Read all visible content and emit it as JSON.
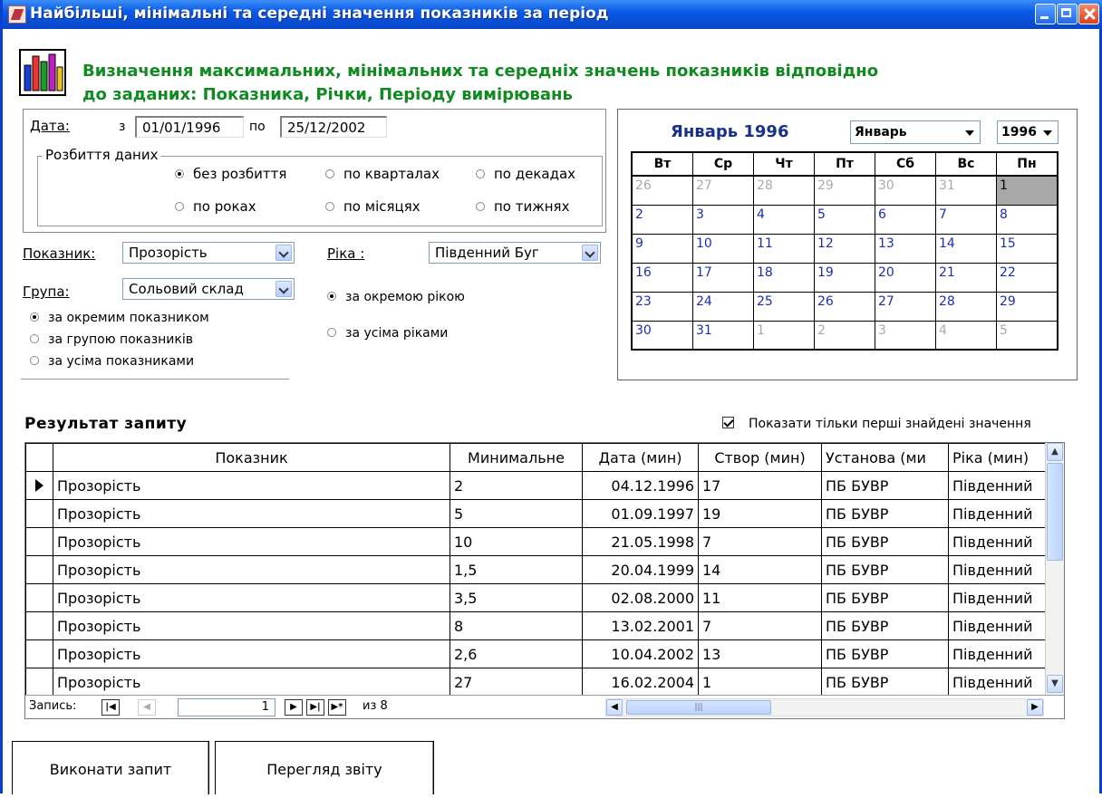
{
  "window": {
    "title": "Найбільші, мінімальні та середні значення показників за період"
  },
  "header": {
    "title": "Визначення максимальних, мінімальних та середніх значень показників відповідно до заданих: Показника, Річки, Періоду вимірювань"
  },
  "date": {
    "label": "Дата:",
    "from_label": "з",
    "from": "01/01/1996",
    "to_label": "по",
    "to": "25/12/2002"
  },
  "split": {
    "label": "Розбиття даних",
    "options": [
      "без розбиття",
      "по кварталах",
      "по декадах",
      "по роках",
      "по місяцях",
      "по тижнях"
    ],
    "selected": "без розбиття"
  },
  "indicator": {
    "label": "Показник:",
    "value": "Прозорість"
  },
  "group": {
    "label": "Група:",
    "value": "Сольовий склад"
  },
  "river": {
    "label": "Ріка :",
    "value": "Південний Буг"
  },
  "indicator_mode": {
    "options": [
      "за окремим показником",
      "за групою показників",
      "за усіма показниками"
    ],
    "selected": "за окремим показником"
  },
  "river_mode": {
    "options": [
      "за окремою рікою",
      "за усіма ріками"
    ],
    "selected": "за окремою рікою"
  },
  "calendar": {
    "heading": "Январь 1996",
    "month_select": "Январь",
    "year_select": "1996",
    "weekdays": [
      "Вт",
      "Ср",
      "Чт",
      "Пт",
      "Сб",
      "Вс",
      "Пн"
    ],
    "weeks": [
      [
        "26",
        "27",
        "28",
        "29",
        "30",
        "31",
        "1"
      ],
      [
        "2",
        "3",
        "4",
        "5",
        "6",
        "7",
        "8"
      ],
      [
        "9",
        "10",
        "11",
        "12",
        "13",
        "14",
        "15"
      ],
      [
        "16",
        "17",
        "18",
        "19",
        "20",
        "21",
        "22"
      ],
      [
        "23",
        "24",
        "25",
        "26",
        "27",
        "28",
        "29"
      ],
      [
        "30",
        "31",
        "1",
        "2",
        "3",
        "4",
        "5"
      ]
    ],
    "selected_day": "1"
  },
  "results": {
    "title": "Результат запиту",
    "only_first_label": "Показати тільки перші знайдені значення",
    "only_first_checked": true,
    "columns": [
      "Показник",
      "Минимальне",
      "Дата (мин)",
      "Створ (мин)",
      "Установа (ми",
      "Ріка (мин)"
    ],
    "rows": [
      [
        "Прозорість",
        "2",
        "04.12.1996",
        "17",
        "ПБ БУВР",
        "Південний"
      ],
      [
        "Прозорість",
        "5",
        "01.09.1997",
        "19",
        "ПБ БУВР",
        "Південний"
      ],
      [
        "Прозорість",
        "10",
        "21.05.1998",
        "7",
        "ПБ БУВР",
        "Південний"
      ],
      [
        "Прозорість",
        "1,5",
        "20.04.1999",
        "14",
        "ПБ БУВР",
        "Південний"
      ],
      [
        "Прозорість",
        "3,5",
        "02.08.2000",
        "11",
        "ПБ БУВР",
        "Південний"
      ],
      [
        "Прозорість",
        "8",
        "13.02.2001",
        "7",
        "ПБ БУВР",
        "Південний"
      ],
      [
        "Прозорість",
        "2,6",
        "10.04.2002",
        "13",
        "ПБ БУВР",
        "Південний"
      ],
      [
        "Прозорість",
        "27",
        "16.02.2004",
        "1",
        "ПБ БУВР",
        "Південний"
      ]
    ],
    "nav": {
      "label": "Запись:",
      "current": "1",
      "of_label": "из 8"
    }
  },
  "buttons": {
    "run": "Виконати запит",
    "report": "Перегляд звіту"
  }
}
